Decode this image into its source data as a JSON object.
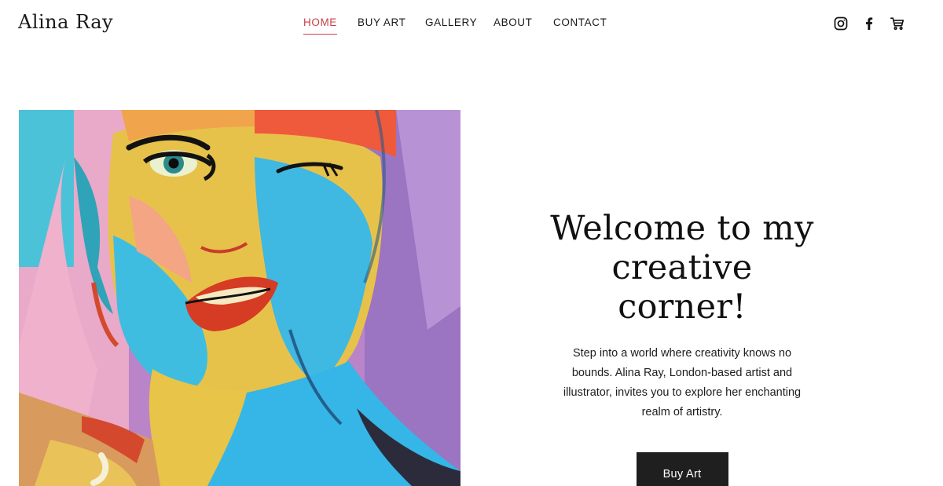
{
  "brand": {
    "name": "Alina Ray"
  },
  "nav": {
    "items": [
      {
        "label": "HOME",
        "active": true
      },
      {
        "label": "BUY ART",
        "active": false
      },
      {
        "label": "GALLERY",
        "active": false
      },
      {
        "label": "ABOUT",
        "active": false
      },
      {
        "label": "CONTACT",
        "active": false
      }
    ]
  },
  "header_icons": [
    "instagram-icon",
    "facebook-icon",
    "cart-icon"
  ],
  "hero": {
    "title_line1": "Welcome to my",
    "title_line2": "creative corner!",
    "text": "Step into a world where creativity knows no bounds. Alina Ray, London-based artist and illustrator, invites you to explore her enchanting realm of artistry.",
    "button_label": "Buy Art"
  },
  "colors": {
    "accent": "#c9414b",
    "button_bg": "#1f1f1f",
    "text": "#1a1a1a"
  }
}
